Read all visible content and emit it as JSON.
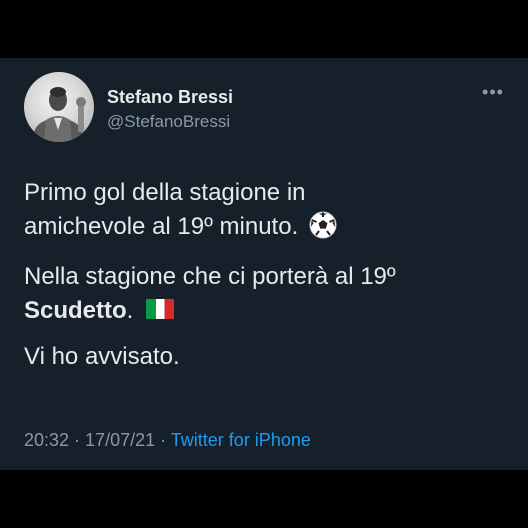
{
  "user": {
    "display_name": "Stefano Bressi",
    "handle": "@StefanoBressi",
    "avatar_icon": "profile-photo"
  },
  "menu": {
    "more_label": "•••"
  },
  "tweet": {
    "line1": "Primo gol della stagione in",
    "line2": "amichevole al 19º minuto.",
    "line3": "Nella stagione che ci porterà al 19º",
    "line4_bold": "Scudetto",
    "line4_after": ".",
    "line5": "Vi ho avvisato.",
    "emoji_1": "soccer-ball-icon",
    "emoji_2": "italy-flag-icon"
  },
  "meta": {
    "time": "20:32",
    "sep1": " · ",
    "date": "17/07/21",
    "sep2": " · ",
    "source": "Twitter for iPhone"
  },
  "colors": {
    "background": "#15202b",
    "text": "#e7e9ea",
    "secondary": "#8b98a5",
    "link": "#1d9bf0"
  }
}
